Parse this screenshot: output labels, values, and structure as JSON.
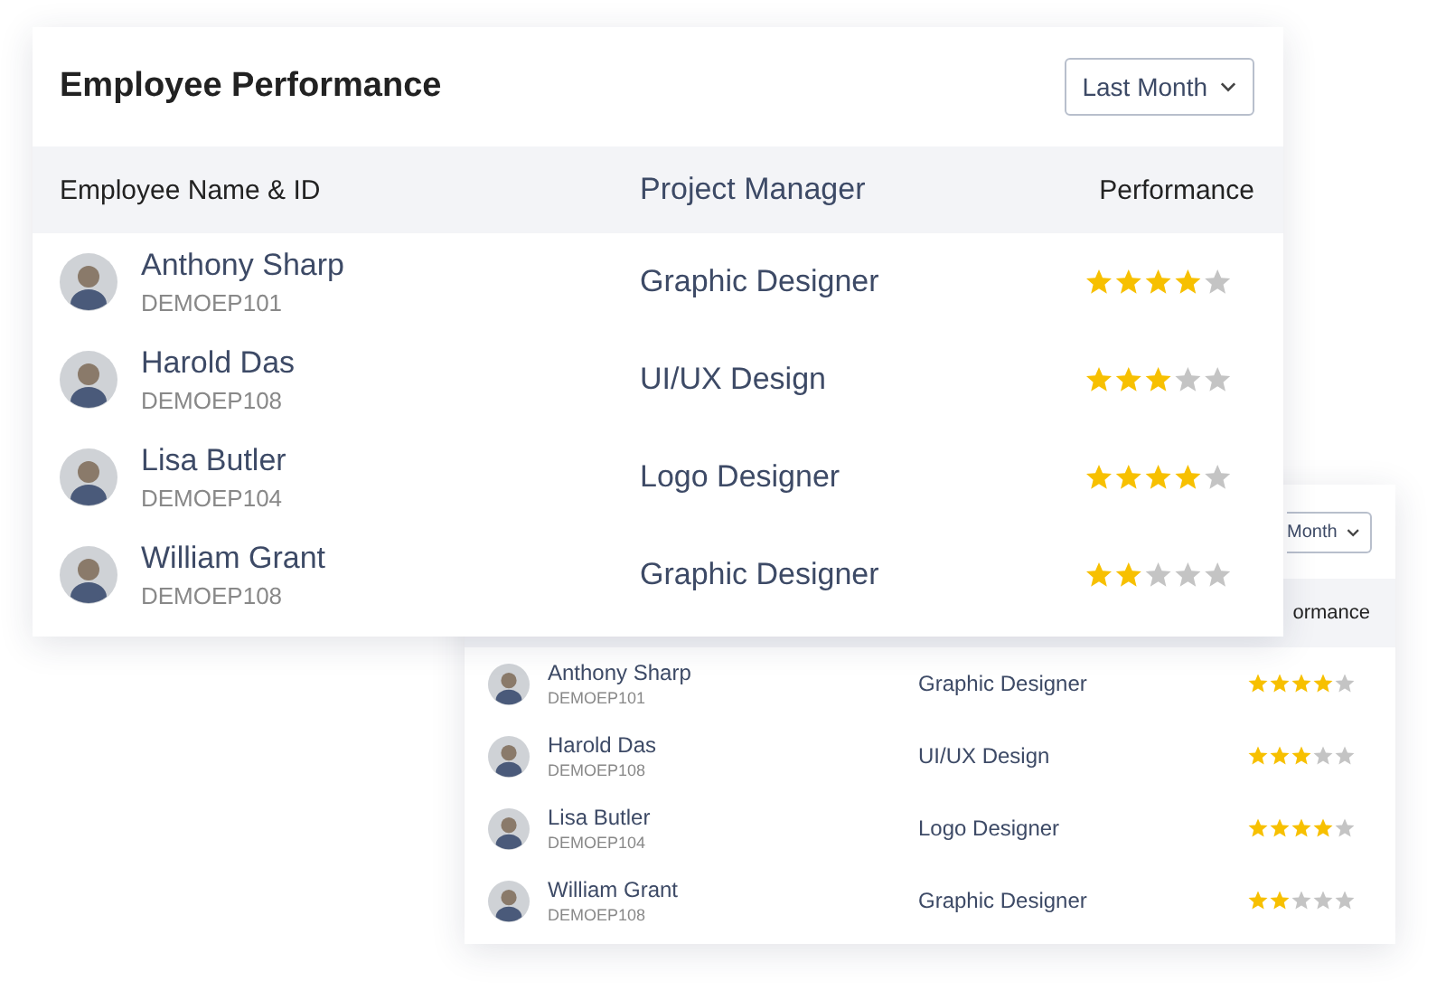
{
  "front_card": {
    "title": "Employee Performance",
    "period_dropdown": "Last Month",
    "columns": [
      "Employee Name & ID",
      "Project Manager",
      "Performance"
    ],
    "rows": [
      {
        "name": "Anthony Sharp",
        "id": "DEMOEP101",
        "role": "Graphic Designer",
        "stars": 4
      },
      {
        "name": "Harold Das",
        "id": "DEMOEP108",
        "role": "UI/UX Design",
        "stars": 3
      },
      {
        "name": "Lisa Butler",
        "id": "DEMOEP104",
        "role": "Logo Designer",
        "stars": 4
      },
      {
        "name": "William Grant",
        "id": "DEMOEP108",
        "role": "Graphic Designer",
        "stars": 2
      }
    ]
  },
  "back_card": {
    "period_dropdown": "Month",
    "columns": [
      "ormance"
    ],
    "rows": [
      {
        "name": "Anthony Sharp",
        "id": "DEMOEP101",
        "role": "Graphic Designer",
        "stars": 4
      },
      {
        "name": "Harold Das",
        "id": "DEMOEP108",
        "role": "UI/UX Design",
        "stars": 3
      },
      {
        "name": "Lisa Butler",
        "id": "DEMOEP104",
        "role": "Logo Designer",
        "stars": 4
      },
      {
        "name": "William Grant",
        "id": "DEMOEP108",
        "role": "Graphic Designer",
        "stars": 2
      }
    ]
  }
}
